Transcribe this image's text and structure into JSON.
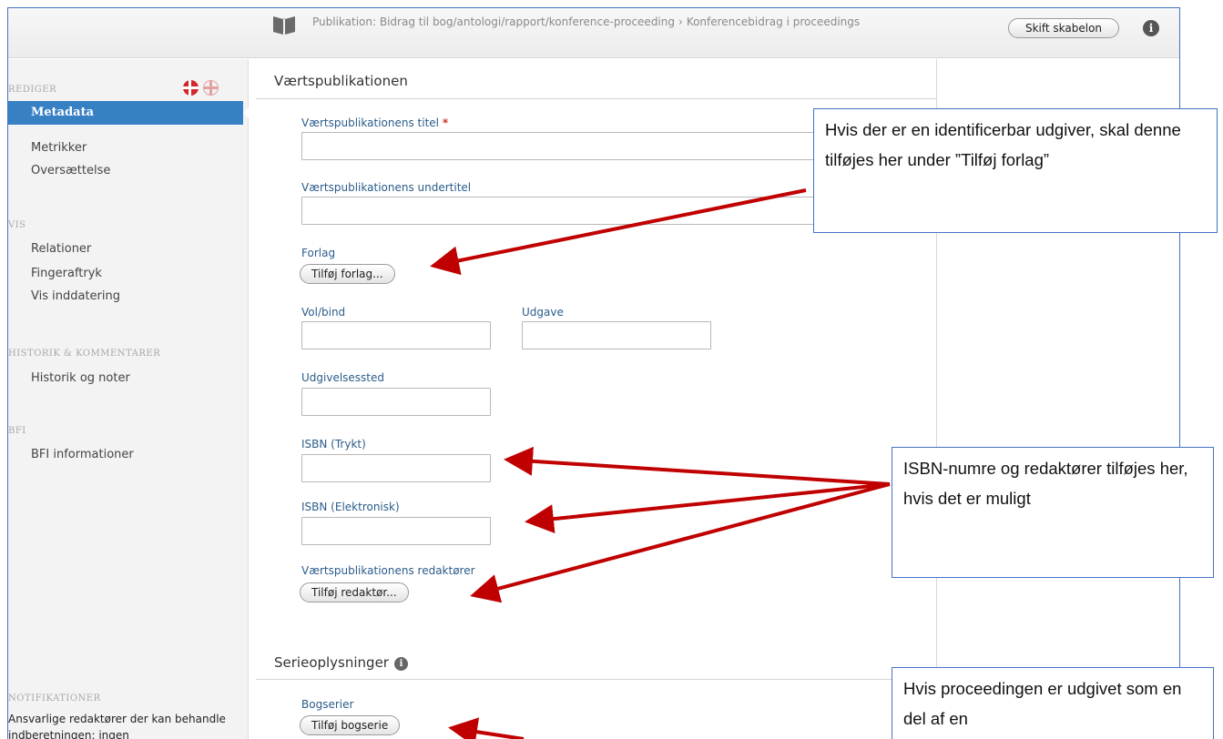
{
  "header": {
    "breadcrumb_1": "Publikation: Bidrag til bog/antologi/rapport/konference-proceeding",
    "breadcrumb_sep": "›",
    "breadcrumb_2": "Konferencebidrag i proceedings",
    "switch_template": "Skift skabelon",
    "info": "i"
  },
  "sidebar": {
    "edit_head": "REDIGER",
    "nav_metadata": "Metadata",
    "nav_metrics": "Metrikker",
    "nav_translation": "Oversættelse",
    "view_head": "VIS",
    "nav_relations": "Relationer",
    "nav_fingerprint": "Fingeraftryk",
    "nav_show_entry": "Vis inddatering",
    "history_head": "HISTORIK & KOMMENTARER",
    "nav_history": "Historik og noter",
    "bfi_head": "BFI",
    "nav_bfi": "BFI informationer",
    "notif_head": "NOTIFIKATIONER",
    "notif_text": "Ansvarlige redaktører der kan behandle indberetningen: ingen"
  },
  "host": {
    "section_title": "Værtspublikationen",
    "title_label": "Værtspublikationens titel",
    "required_mark": "*",
    "title_value": "",
    "subtitle_label": "Værtspublikationens undertitel",
    "subtitle_value": "",
    "publisher_label": "Forlag",
    "add_publisher": "Tilføj forlag...",
    "volume_label": "Vol/bind",
    "volume_value": "",
    "edition_label": "Udgave",
    "edition_value": "",
    "place_label": "Udgivelsessted",
    "place_value": "",
    "isbn_print_label": "ISBN (Trykt)",
    "isbn_print_value": "",
    "isbn_electronic_label": "ISBN (Elektronisk)",
    "isbn_electronic_value": "",
    "editors_label": "Værtspublikationens redaktører",
    "add_editor": "Tilføj redaktør..."
  },
  "series": {
    "section_title": "Serieoplysninger",
    "info": "i",
    "book_series_label": "Bogserier",
    "add_series": "Tilføj bogserie"
  },
  "callouts": {
    "publisher_note": "Hvis der er en identificerbar udgiver, skal denne tilføjes her under ”Tilføj forlag”",
    "isbn_note": "ISBN-numre og redaktører tilføjes her, hvis det er muligt",
    "series_note": "Hvis proceedingen er udgivet som en del af en"
  },
  "colors": {
    "accent": "#3880c4",
    "callout_border": "#4472c4",
    "arrow": "#c00000",
    "label": "#2b5c8a"
  }
}
